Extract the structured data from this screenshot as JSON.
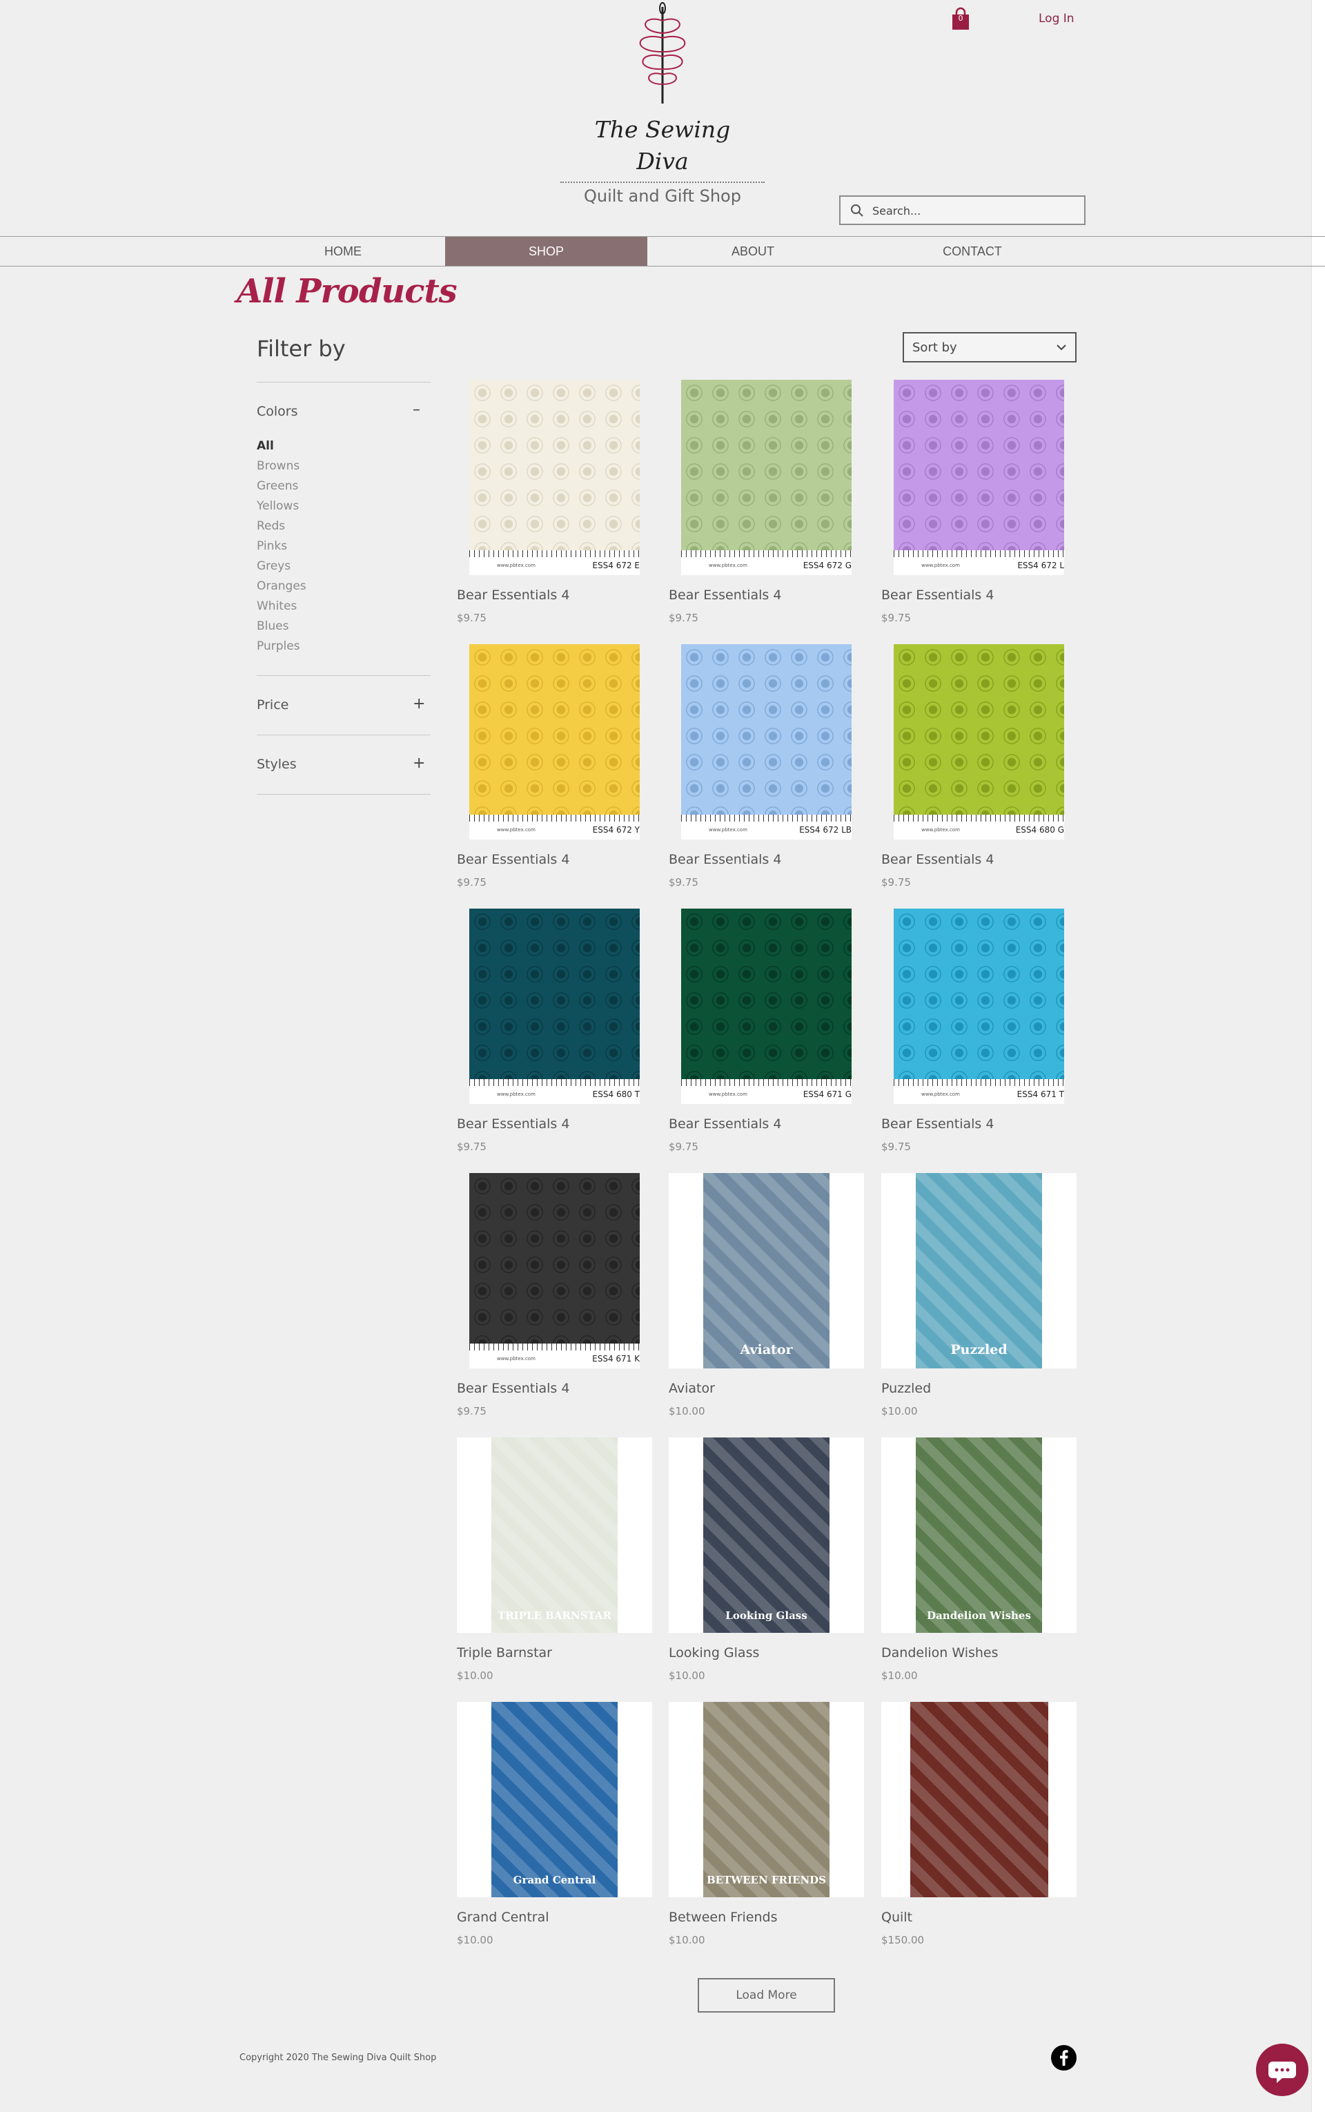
{
  "header": {
    "logo_title_line1": "The Sewing",
    "logo_title_line2": "Diva",
    "logo_subtitle": "Quilt and Gift Shop",
    "cart_count": "0",
    "login_label": "Log In",
    "search_placeholder": "Search..."
  },
  "nav": {
    "items": [
      {
        "label": "HOME",
        "active": false
      },
      {
        "label": "SHOP",
        "active": true
      },
      {
        "label": "ABOUT",
        "active": false
      },
      {
        "label": "CONTACT",
        "active": false
      }
    ]
  },
  "page_title": "All Products",
  "filter": {
    "title": "Filter by",
    "colors_label": "Colors",
    "colors_toggle": "–",
    "colors": [
      "All",
      "Browns",
      "Greens",
      "Yellows",
      "Reds",
      "Pinks",
      "Greys",
      "Oranges",
      "Whites",
      "Blues",
      "Purples"
    ],
    "selected_color": "All",
    "price_label": "Price",
    "price_toggle": "+",
    "styles_label": "Styles",
    "styles_toggle": "+"
  },
  "sort": {
    "label": "Sort by"
  },
  "products": [
    {
      "name": "Bear Essentials 4",
      "price": "$9.75",
      "code": "ESS4 672 E",
      "color": "#f3efe2",
      "motif": "#ddd6c3"
    },
    {
      "name": "Bear Essentials 4",
      "price": "$9.75",
      "code": "ESS4 672 G",
      "color": "#b6cd98",
      "motif": "#96b078"
    },
    {
      "name": "Bear Essentials 4",
      "price": "$9.75",
      "code": "ESS4 672 L",
      "color": "#c49ae8",
      "motif": "#a67acb"
    },
    {
      "name": "Bear Essentials 4",
      "price": "$9.75",
      "code": "ESS4 672 Y",
      "color": "#f4cd44",
      "motif": "#dcb22c"
    },
    {
      "name": "Bear Essentials 4",
      "price": "$9.75",
      "code": "ESS4 672 LB",
      "color": "#a6c9f1",
      "motif": "#7fa7d6"
    },
    {
      "name": "Bear Essentials 4",
      "price": "$9.75",
      "code": "ESS4 680 G",
      "color": "#aac534",
      "motif": "#84a01c"
    },
    {
      "name": "Bear Essentials 4",
      "price": "$9.75",
      "code": "ESS4 680 T",
      "color": "#0f4f5c",
      "motif": "#093a44"
    },
    {
      "name": "Bear Essentials 4",
      "price": "$9.75",
      "code": "ESS4 671 G",
      "color": "#0b5237",
      "motif": "#063a25"
    },
    {
      "name": "Bear Essentials 4",
      "price": "$9.75",
      "code": "ESS4 671 T",
      "color": "#3ab6dc",
      "motif": "#1e93ba"
    },
    {
      "name": "Bear Essentials 4",
      "price": "$9.75",
      "code": "ESS4 671 K",
      "color": "#363636",
      "motif": "#242424"
    },
    {
      "name": "Aviator",
      "price": "$10.00",
      "cover_text": "Aviator",
      "cover": "#6f8aa1"
    },
    {
      "name": "Puzzled",
      "price": "$10.00",
      "cover_text": "Puzzled",
      "cover": "#5fa9c0"
    },
    {
      "name": "Triple Barnstar",
      "price": "$10.00",
      "cover_text": "TRIPLE BARNSTAR",
      "cover": "#e3e7dc"
    },
    {
      "name": "Looking Glass",
      "price": "$10.00",
      "cover_text": "Looking Glass",
      "cover": "#3c4556"
    },
    {
      "name": "Dandelion Wishes",
      "price": "$10.00",
      "cover_text": "Dandelion Wishes",
      "cover": "#5b7c4e"
    },
    {
      "name": "Grand Central",
      "price": "$10.00",
      "cover_text": "Grand Central",
      "cover": "#2b6aa8"
    },
    {
      "name": "Between Friends",
      "price": "$10.00",
      "cover_text": "BETWEEN FRIENDS",
      "cover": "#8f8770"
    },
    {
      "name": "Quilt",
      "price": "$150.00",
      "cover_text": "",
      "cover": "#6e2c25"
    }
  ],
  "fabric_site": "www.pbtex.com",
  "load_more_label": "Load More",
  "footer": {
    "copyright": "Copyright 2020 The Sewing Diva Quilt Shop"
  },
  "colors": {
    "accent": "#a8214a",
    "nav_active": "#876f72",
    "chat": "#9a1e44"
  }
}
